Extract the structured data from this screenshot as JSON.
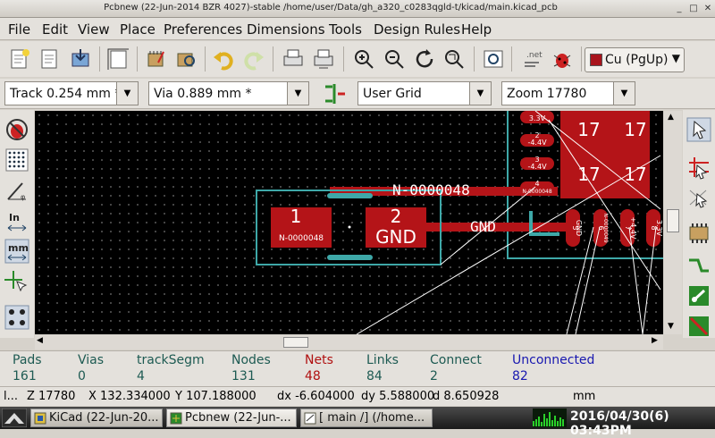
{
  "window": {
    "title": "Pcbnew (22-Jun-2014 BZR 4027)-stable /home/user/Data/gh_a320_c0283qgld-t/kicad/main.kicad_pcb"
  },
  "menu": [
    "File",
    "Edit",
    "View",
    "Place",
    "Preferences",
    "Dimensions",
    "Tools",
    "Design Rules",
    "Help"
  ],
  "toolbar": {
    "icons": [
      "new-board-icon",
      "open-board-icon",
      "save-icon",
      "page-settings-icon",
      "module-editor-icon",
      "library-browser-icon",
      "undo-icon",
      "redo-icon",
      "print-icon",
      "plot-icon",
      "zoom-in-icon",
      "zoom-out-icon",
      "redraw-icon",
      "zoom-fit-icon",
      "find-icon",
      "netlist-icon",
      "drc-icon"
    ],
    "layer": "Cu (PgUp)"
  },
  "options": {
    "track": "Track 0.254 mm *",
    "via": "Via 0.889 mm *",
    "grid": "User Grid",
    "zoom": "Zoom 17780"
  },
  "canvas": {
    "pad1": "1",
    "pad1_net": "N-0000048",
    "pad2": "2",
    "pad2_net": "GND",
    "trace_net_label": "N-0000048",
    "gnd_label": "GND",
    "big_pad_a": "17",
    "big_pad_b": "17",
    "big_pad_c": "17",
    "big_pad_d": "17",
    "ic_pins_left": [
      "3.3V",
      "2",
      "-4.4V",
      "3",
      "-4.4V",
      "4",
      "N-0000048"
    ],
    "ic_pins_bottom": [
      "5",
      "GND",
      "6",
      "N-0000049",
      "7",
      "+4.4V",
      "8",
      "3.3V"
    ]
  },
  "stats": [
    {
      "label": "Pads",
      "value": "161",
      "color": "#1d5a52"
    },
    {
      "label": "Vias",
      "value": "0",
      "color": "#1d5a52"
    },
    {
      "label": "trackSegm",
      "value": "4",
      "color": "#1d5a52"
    },
    {
      "label": "Nodes",
      "value": "131",
      "color": "#1d5a52"
    },
    {
      "label": "Nets",
      "value": "48",
      "color": "#b01010"
    },
    {
      "label": "Links",
      "value": "84",
      "color": "#1d5a52"
    },
    {
      "label": "Connect",
      "value": "2",
      "color": "#1d5a52"
    },
    {
      "label": "Unconnected",
      "value": "82",
      "color": "#1818b0"
    }
  ],
  "status": {
    "col0": "l...",
    "zoom": "Z 17780",
    "x": "X 132.334000",
    "y": "Y 107.188000",
    "dx": "dx -6.604000",
    "dy": "dy 5.588000",
    "d": "d 8.650928",
    "units": "mm"
  },
  "taskbar": {
    "tasks": [
      "KiCad (22-Jun-20...",
      "Pcbnew (22-Jun-...",
      "[ main /] (/home..."
    ],
    "clock": "2016/04/30(6) 03:43PM"
  },
  "colors": {
    "pad": "#b41418",
    "outline": "#3ea8a8",
    "silk": "#ffffff"
  }
}
